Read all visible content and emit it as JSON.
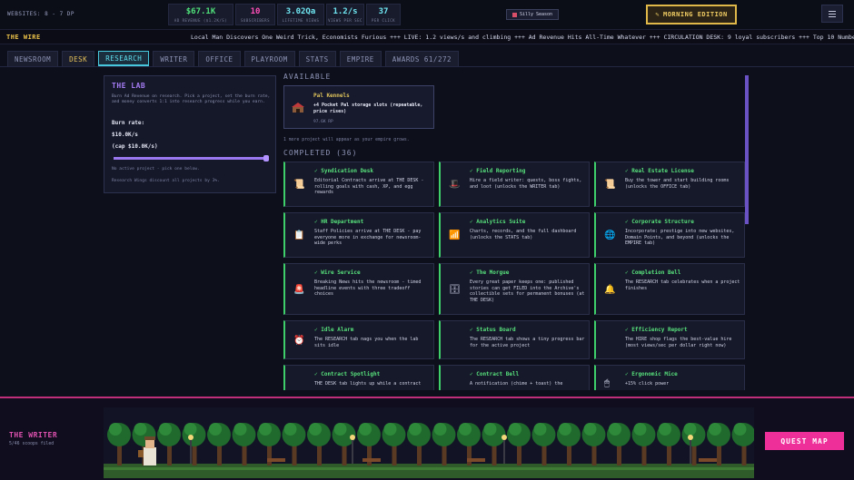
{
  "header": {
    "websites": "WEBSITES: 8 - 7 DP",
    "stats": [
      {
        "value": "$67.1K",
        "label": "AD REVENUE ($1.2K/S)",
        "color": "#4fe07a",
        "width": 72
      },
      {
        "value": "10",
        "label": "SUBSCRIBERS",
        "color": "#ff4fb8",
        "width": 44
      },
      {
        "value": "3.02Qa",
        "label": "LIFETIME VIEWS",
        "color": "#6fe6f2",
        "width": 52
      },
      {
        "value": "1.2/s",
        "label": "VIEWS PER SEC",
        "color": "#6fe6f2",
        "width": 42
      },
      {
        "value": "37",
        "label": "PER CLICK",
        "color": "#6fe6f2",
        "width": 38
      }
    ],
    "season_badge": "Silly Season",
    "edition_button": "MORNING EDITION"
  },
  "ticker": {
    "label": "THE WIRE",
    "text": "Local Man Discovers One Weird Trick, Economists Furious +++ LIVE: 1.2 views/s and climbing +++ Ad Revenue Hits All-Time Whatever +++ CIRCULATION DESK: 9 loyal subscribers +++ Top 10 Numbers That Went Up"
  },
  "tabs": [
    "NEWSROOM",
    "DESK",
    "RESEARCH",
    "WRITER",
    "OFFICE",
    "PLAYROOM",
    "STATS",
    "EMPIRE",
    "AWARDS 61/272"
  ],
  "active_tab": "RESEARCH",
  "lab": {
    "title": "THE LAB",
    "description": "Burn Ad Revenue on research. Pick a project, set the burn rate, and money converts 1:1 into research progress while you earn.",
    "burn_label": "Burn rate:",
    "burn_value": "$10.0K/s",
    "burn_cap": "(cap $10.0K/s)",
    "slider_fraction": 1.0,
    "no_project": "No active project - pick one below.",
    "discount_note": "Research Wings discount all projects by 3%."
  },
  "available": {
    "heading": "AVAILABLE",
    "project": {
      "name": "Pal Kennels",
      "effect": "+4 Pocket Pal storage slots (repeatable, price rises)",
      "cost": "97.6K RP"
    },
    "more_note": "1 more project will appear as your empire grows."
  },
  "completed": {
    "heading": "COMPLETED (36)",
    "cards": [
      {
        "title": "✓ Syndication Desk",
        "desc": "Editorial Contracts arrive at THE DESK - rolling goals with cash, XP, and egg rewards",
        "icon": "scroll-icon",
        "glyph": "📜"
      },
      {
        "title": "✓ Field Reporting",
        "desc": "Hire a field writer: quests, boss fights, and loot (unlocks the WRITER tab)",
        "icon": "hat-icon",
        "glyph": "🎩"
      },
      {
        "title": "✓ Real Estate License",
        "desc": "Buy the tower and start building rooms (unlocks the OFFICE tab)",
        "icon": "deed-icon",
        "glyph": "📜"
      },
      {
        "title": "✓ HR Department",
        "desc": "Staff Policies arrive at THE DESK - pay everyone more in exchange for newsroom-wide perks",
        "icon": "clipboard-icon",
        "glyph": "📋"
      },
      {
        "title": "✓ Analytics Suite",
        "desc": "Charts, records, and the full dashboard (unlocks the STATS tab)",
        "icon": "chart-icon",
        "glyph": "📶"
      },
      {
        "title": "✓ Corporate Structure",
        "desc": "Incorporate: prestige into new websites, Domain Points, and beyond (unlocks the EMPIRE tab)",
        "icon": "globe-icon",
        "glyph": "🌐"
      },
      {
        "title": "✓ Wire Service",
        "desc": "Breaking News hits the newsroom - timed headline events with three tradeoff choices",
        "icon": "siren-icon",
        "glyph": "🚨"
      },
      {
        "title": "✓ The Morgue",
        "desc": "Every great paper keeps one: published stories can get FILED into the Archive's collectible sets for permanent bonuses (at THE DESK)",
        "icon": "cabinet-icon",
        "glyph": "🗄"
      },
      {
        "title": "✓ Completion Bell",
        "desc": "The RESEARCH tab celebrates when a project finishes",
        "icon": "bell-icon",
        "glyph": "🔔"
      },
      {
        "title": "✓ Idle Alarm",
        "desc": "The RESEARCH tab nags you when the lab sits idle",
        "icon": "alarm-icon",
        "glyph": "⏰"
      },
      {
        "title": "✓ Status Board",
        "desc": "The RESEARCH tab shows a tiny progress bar for the active project",
        "icon": "",
        "glyph": ""
      },
      {
        "title": "✓ Efficiency Report",
        "desc": "The HIRE shop flags the best-value hire (most views/sec per dollar right now)",
        "icon": "",
        "glyph": ""
      },
      {
        "title": "✓ Contract Spotlight",
        "desc": "THE DESK tab lights up while a contract",
        "icon": "",
        "glyph": ""
      },
      {
        "title": "✓ Contract Bell",
        "desc": "A notification (chime + toast) the",
        "icon": "",
        "glyph": ""
      },
      {
        "title": "✓ Ergonomic Mice",
        "desc": "+15% click power",
        "icon": "mouse-icon",
        "glyph": "🖱"
      }
    ]
  },
  "writer": {
    "title": "THE WRITER",
    "subtitle": "5/46 scoops filed",
    "quest_button": "QUEST MAP"
  }
}
